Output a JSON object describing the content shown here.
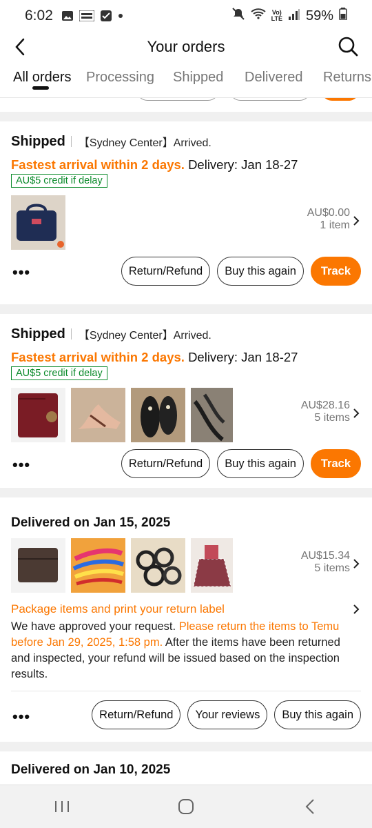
{
  "status_bar": {
    "time": "6:02",
    "battery": "59%"
  },
  "header": {
    "title": "Your orders"
  },
  "tabs": [
    {
      "label": "All orders",
      "active": true
    },
    {
      "label": "Processing",
      "active": false
    },
    {
      "label": "Shipped",
      "active": false
    },
    {
      "label": "Delivered",
      "active": false
    },
    {
      "label": "Returns",
      "active": false
    }
  ],
  "orders": [
    {
      "status": "Shipped",
      "arrival": "【Sydney Center】Arrived.",
      "fastest": "Fastest arrival within 2 days.",
      "delivery": "Delivery: Jan 18-27",
      "credit": "AU$5 credit if delay",
      "price": "AU$0.00",
      "count": "1 item",
      "buttons": {
        "refund": "Return/Refund",
        "again": "Buy this again",
        "track": "Track"
      }
    },
    {
      "status": "Shipped",
      "arrival": "【Sydney Center】Arrived.",
      "fastest": "Fastest arrival within 2 days.",
      "delivery": "Delivery: Jan 18-27",
      "credit": "AU$5 credit if delay",
      "price": "AU$28.16",
      "count": "5 items",
      "buttons": {
        "refund": "Return/Refund",
        "again": "Buy this again",
        "track": "Track"
      }
    },
    {
      "status": "Delivered on Jan 15, 2025",
      "price": "AU$15.34",
      "count": "5 items",
      "package_title": "Package items and print your return label",
      "desc_1": "We have approved your request. ",
      "desc_highlight": "Please return the items to Temu before Jan 29, 2025, 1:58 pm.",
      "desc_2": " After the items have been returned and inspected, your refund will be issued based on the inspection results.",
      "buttons": {
        "refund": "Return/Refund",
        "reviews": "Your reviews",
        "again": "Buy this again"
      }
    },
    {
      "status": "Delivered on Jan 10, 2025"
    }
  ],
  "colors": {
    "accent": "#fb7701",
    "credit_green": "#0a8a2a"
  }
}
